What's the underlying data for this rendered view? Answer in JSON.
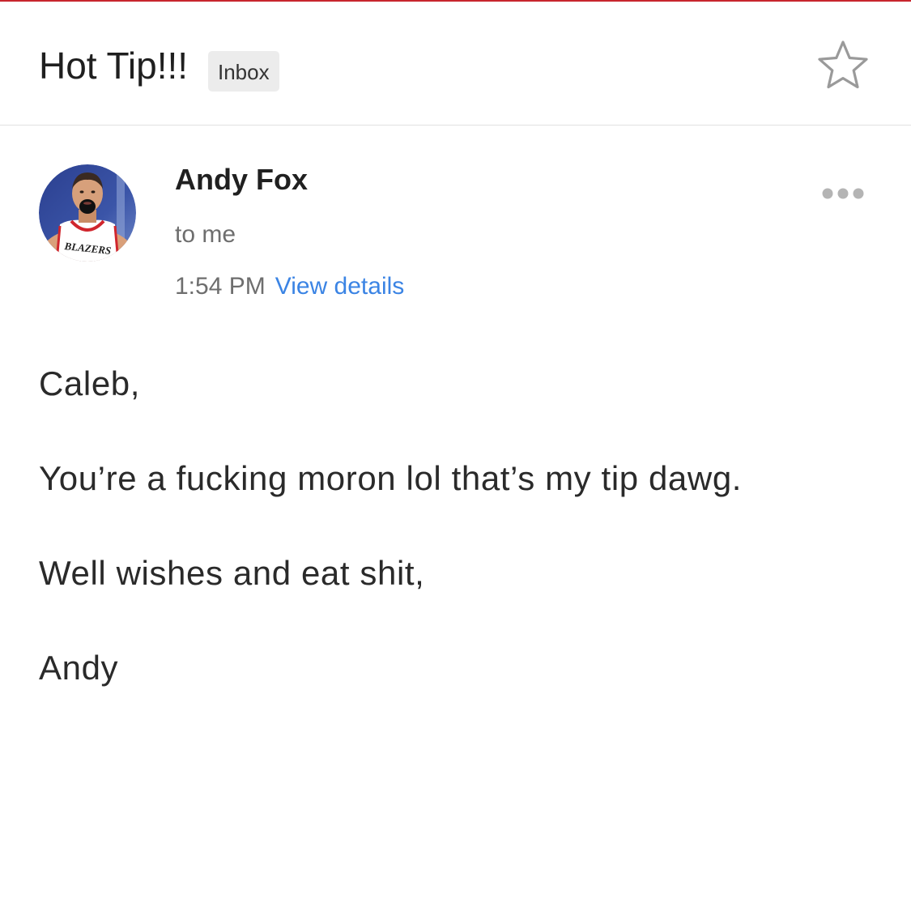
{
  "header": {
    "subject": "Hot Tip!!!",
    "label": "Inbox",
    "star_icon": "star-outline-icon"
  },
  "message": {
    "sender_name": "Andy Fox",
    "recipient": "to me",
    "time": "1:54 PM",
    "view_details_label": "View details",
    "avatar_jersey_text": "BLAZERS",
    "more_icon": "more-horizontal-icon",
    "body": {
      "greeting": "Caleb,",
      "line1": "You’re a fucking moron lol that’s my tip dawg.",
      "signoff": "Well wishes and eat shit,",
      "signature": "Andy"
    }
  },
  "colors": {
    "accent_line": "#c8262d",
    "link": "#3b84e4",
    "chip_background": "#ececec",
    "muted_text": "#6e6e6e"
  }
}
